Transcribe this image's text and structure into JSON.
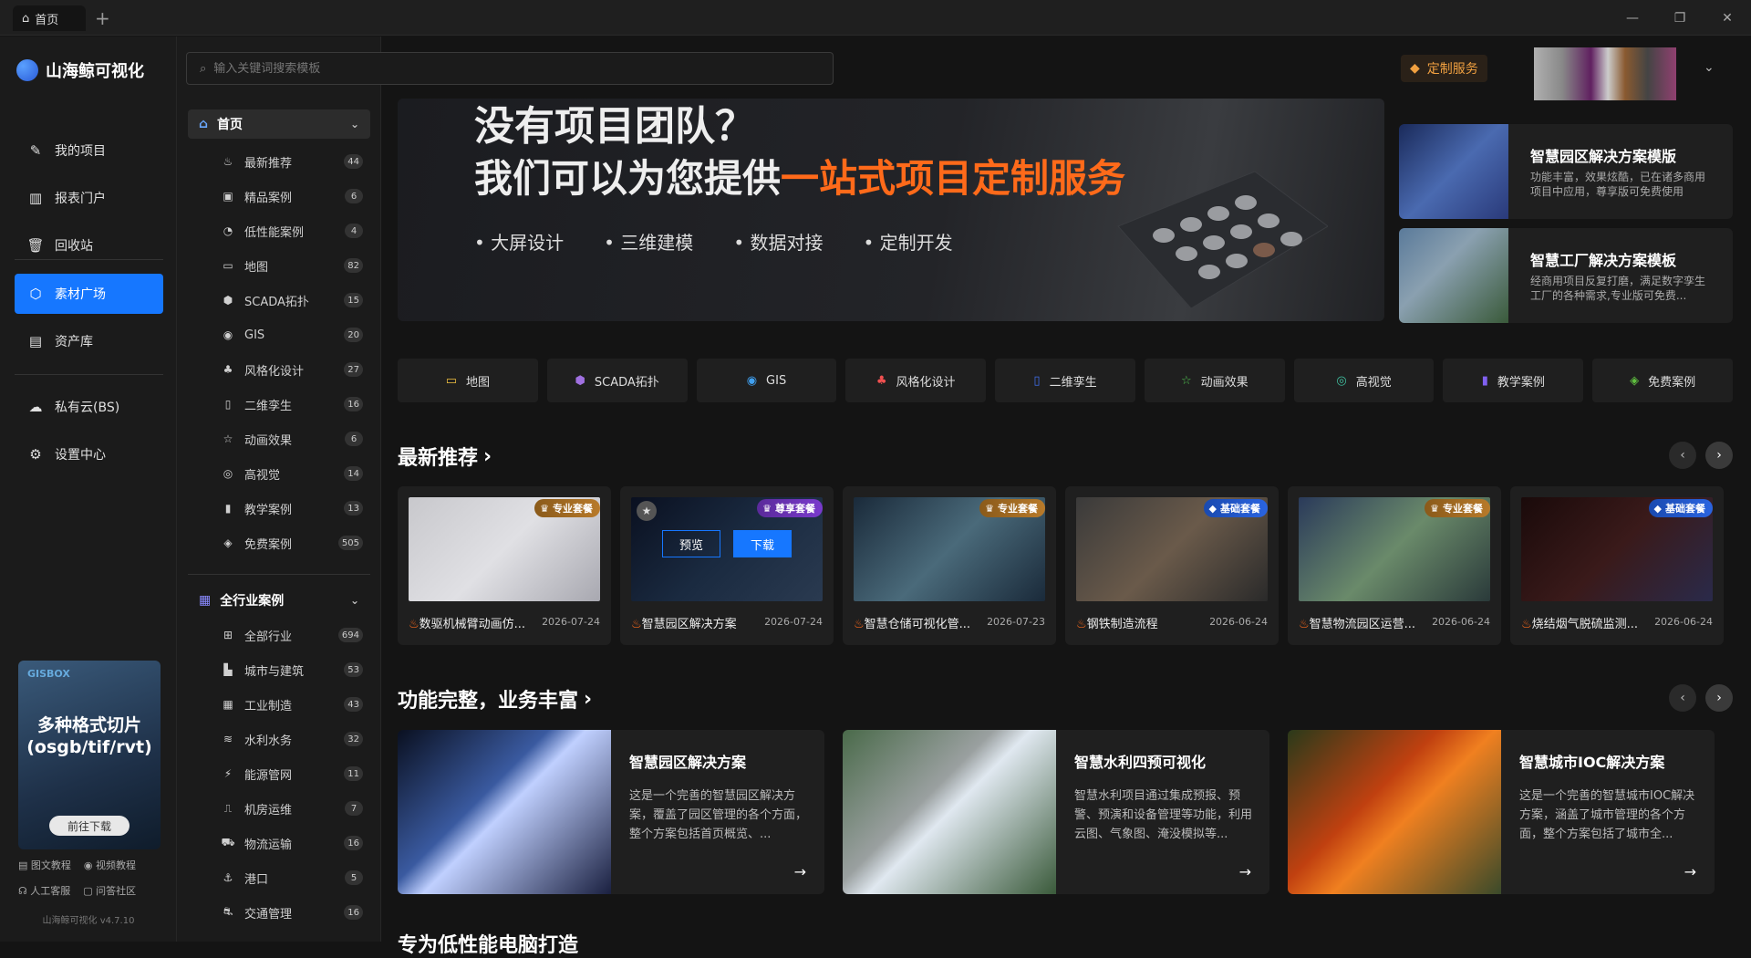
{
  "titlebar": {
    "tab_label": "首页",
    "new_tab": "+",
    "minimize": "—",
    "restore": "❐",
    "close": "✕"
  },
  "brand": {
    "name": "山海鲸可视化",
    "version": "山海鲸可视化 v4.7.10"
  },
  "nav": [
    {
      "label": "我的项目",
      "icon": "✎"
    },
    {
      "label": "报表门户",
      "icon": "▥"
    },
    {
      "label": "回收站",
      "icon": "🗑"
    },
    {
      "label": "素材广场",
      "icon": "⬡"
    },
    {
      "label": "资产库",
      "icon": "▤"
    },
    {
      "label": "私有云(BS)",
      "icon": "☁"
    },
    {
      "label": "设置中心",
      "icon": "⚙"
    }
  ],
  "promo": {
    "brand": "GISBOX",
    "line1": "多种格式切片",
    "line2": "(osgb/tif/rvt)",
    "button": "前往下载"
  },
  "help_links": [
    "图文教程",
    "视频教程",
    "人工客服",
    "问答社区"
  ],
  "search": {
    "placeholder": "输入关键词搜索模板",
    "value": ""
  },
  "service": {
    "label": "定制服务"
  },
  "groups": [
    {
      "label": "首页",
      "items": [
        {
          "label": "最新推荐",
          "count": "44",
          "icon": "♨"
        },
        {
          "label": "精品案例",
          "count": "6",
          "icon": "▣"
        },
        {
          "label": "低性能案例",
          "count": "4",
          "icon": "◔"
        },
        {
          "label": "地图",
          "count": "82",
          "icon": "▭"
        },
        {
          "label": "SCADA拓扑",
          "count": "15",
          "icon": "⬢"
        },
        {
          "label": "GIS",
          "count": "20",
          "icon": "◉"
        },
        {
          "label": "风格化设计",
          "count": "27",
          "icon": "♣"
        },
        {
          "label": "二维孪生",
          "count": "16",
          "icon": "▯"
        },
        {
          "label": "动画效果",
          "count": "6",
          "icon": "☆"
        },
        {
          "label": "高视觉",
          "count": "14",
          "icon": "◎"
        },
        {
          "label": "教学案例",
          "count": "13",
          "icon": "▮"
        },
        {
          "label": "免费案例",
          "count": "505",
          "icon": "◈"
        }
      ]
    },
    {
      "label": "全行业案例",
      "items": [
        {
          "label": "全部行业",
          "count": "694",
          "icon": "⊞"
        },
        {
          "label": "城市与建筑",
          "count": "53",
          "icon": "▙"
        },
        {
          "label": "工业制造",
          "count": "43",
          "icon": "▦"
        },
        {
          "label": "水利水务",
          "count": "32",
          "icon": "≋"
        },
        {
          "label": "能源管网",
          "count": "11",
          "icon": "⚡"
        },
        {
          "label": "机房运维",
          "count": "7",
          "icon": "⎍"
        },
        {
          "label": "物流运输",
          "count": "16",
          "icon": "⛟"
        },
        {
          "label": "港口",
          "count": "5",
          "icon": "⚓"
        },
        {
          "label": "交通管理",
          "count": "16",
          "icon": "⛐"
        }
      ]
    }
  ],
  "banner": {
    "line1": "没有项目团队？",
    "line2a": "我们可以为您提供",
    "line2b": "一站式项目定制服务",
    "features": [
      "• 大屏设计",
      "• 三维建模",
      "• 数据对接",
      "• 定制开发"
    ]
  },
  "side_templates": [
    {
      "title": "智慧园区解决方案模版",
      "desc": "功能丰富，效果炫酷，已在诸多商用项目中应用，尊享版可免费使用"
    },
    {
      "title": "智慧工厂解决方案模板",
      "desc": "经商用项目反复打磨，满足数字孪生工厂的各种需求,专业版可免费..."
    }
  ],
  "quick_tabs": [
    {
      "label": "地图",
      "icon": "▭",
      "color": "#f0c040"
    },
    {
      "label": "SCADA拓扑",
      "icon": "⬢",
      "color": "#a070e0"
    },
    {
      "label": "GIS",
      "icon": "◉",
      "color": "#40a0f0"
    },
    {
      "label": "风格化设计",
      "icon": "♣",
      "color": "#f05050"
    },
    {
      "label": "二维孪生",
      "icon": "▯",
      "color": "#4070f0"
    },
    {
      "label": "动画效果",
      "icon": "☆",
      "color": "#50c050"
    },
    {
      "label": "高视觉",
      "icon": "◎",
      "color": "#40c0a0"
    },
    {
      "label": "教学案例",
      "icon": "▮",
      "color": "#8060f0"
    },
    {
      "label": "免费案例",
      "icon": "◈",
      "color": "#60c040"
    }
  ],
  "section1": {
    "title": "最新推荐",
    "prev": "‹",
    "next": "›",
    "cards": [
      {
        "name": "数驱机械臂动画仿...",
        "date": "2026-07-24",
        "badge": "专业套餐",
        "tier": "pro"
      },
      {
        "name": "智慧园区解决方案",
        "date": "2026-07-24",
        "badge": "尊享套餐",
        "tier": "ent",
        "preview": "预览",
        "download": "下载"
      },
      {
        "name": "智慧仓储可视化管...",
        "date": "2026-07-23",
        "badge": "专业套餐",
        "tier": "pro"
      },
      {
        "name": "钢铁制造流程",
        "date": "2026-06-24",
        "badge": "基础套餐",
        "tier": "base"
      },
      {
        "name": "智慧物流园区运营...",
        "date": "2026-06-24",
        "badge": "专业套餐",
        "tier": "pro"
      },
      {
        "name": "烧结烟气脱硫监测...",
        "date": "2026-06-24",
        "badge": "基础套餐",
        "tier": "base"
      }
    ]
  },
  "section2": {
    "title": "功能完整，业务丰富",
    "prev": "‹",
    "next": "›",
    "cards": [
      {
        "title": "智慧园区解决方案",
        "desc": "这是一个完善的智慧园区解决方案，覆盖了园区管理的各个方面，整个方案包括首页概览、..."
      },
      {
        "title": "智慧水利四预可视化",
        "desc": "智慧水利项目通过集成预报、预警、预演和设备管理等功能，利用云图、气象图、淹没模拟等..."
      },
      {
        "title": "智慧城市IOC解决方案",
        "desc": "这是一个完善的智慧城市IOC解决方案，涵盖了城市管理的各个方面，整个方案包括了城市全..."
      }
    ]
  },
  "section3": {
    "title": "专为低性能电脑打造"
  }
}
